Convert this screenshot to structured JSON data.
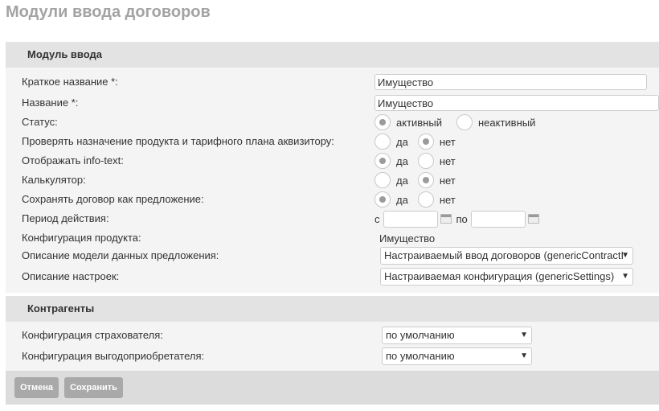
{
  "page": {
    "title": "Модули ввода договоров"
  },
  "section_module": {
    "header": "Модуль ввода",
    "short_name_label": "Краткое название *:",
    "short_name_value": "Имущество",
    "name_label": "Название *:",
    "name_value": "Имущество",
    "status_label": "Статус:",
    "status_options": [
      "активный",
      "неактивный"
    ],
    "status_selected": "активный",
    "check_assign_label": "Проверять назначение продукта и тарифного плана аквизитору:",
    "check_assign_selected": "нет",
    "info_text_label": "Отображать info-text:",
    "info_text_selected": "да",
    "calculator_label": "Калькулятор:",
    "calculator_selected": "нет",
    "save_as_offer_label": "Сохранять договор как предложение:",
    "save_as_offer_selected": "да",
    "yes": "да",
    "no": "нет",
    "period_label": "Период действия:",
    "period_from": "с",
    "period_to": "по",
    "period_from_value": "",
    "period_to_value": "",
    "product_config_label": "Конфигурация продукта:",
    "product_config_value": "Имущество",
    "data_model_label": "Описание модели данных предложения:",
    "data_model_value": "Настраиваемый ввод договоров (genericContractI",
    "settings_label": "Описание настроек:",
    "settings_value": "Настраиваемая конфигурация (genericSettings)"
  },
  "section_contragents": {
    "header": "Контрагенты",
    "insurer_config_label": "Конфигурация страхователя:",
    "insurer_config_value": "по умолчанию",
    "beneficiary_config_label": "Конфигурация выгодоприобретателя:",
    "beneficiary_config_value": "по умолчанию"
  },
  "buttons": {
    "cancel": "Отмена",
    "save": "Сохранить"
  },
  "icons": {
    "select_arrow": "▼"
  }
}
